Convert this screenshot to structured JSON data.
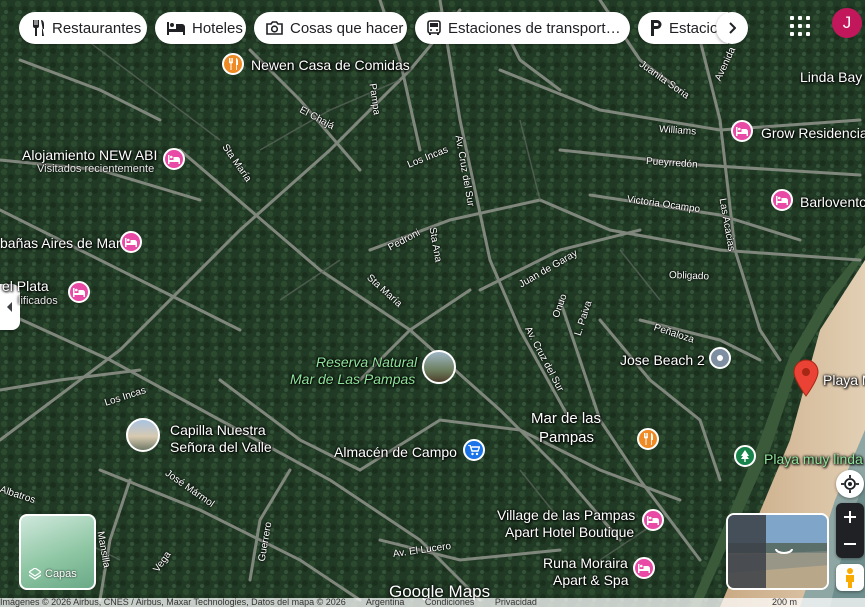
{
  "chips": [
    {
      "label": "Restaurantes",
      "icon": "fork-knife-icon"
    },
    {
      "label": "Hoteles",
      "icon": "bed-icon"
    },
    {
      "label": "Cosas que hacer",
      "icon": "camera-icon"
    },
    {
      "label": "Estaciones de transport…",
      "icon": "bus-icon"
    },
    {
      "label": "Estacio",
      "icon": "parking-icon"
    }
  ],
  "avatar_letter": "J",
  "places": {
    "newen": "Newen Casa de Comidas",
    "linda_bay": "Linda Bay",
    "grow": "Grow Residencia",
    "alojamiento": "Alojamiento NEW ABI",
    "alojamiento_sub": "Visitados recientemente",
    "barlovento": "Barlovento",
    "banas": "bañas Aires de Mar",
    "plata": "el Plata",
    "plata_sub": "lificados",
    "reserva_line1": "Reserva Natural",
    "reserva_line2": "Mar de Las Pampas",
    "jose_beach": "Jose Beach 2",
    "playa": "Playa M",
    "capilla_line1": "Capilla Nuestra",
    "capilla_line2": "Señora del Valle",
    "mar_line1": "Mar de las",
    "mar_line2": "Pampas",
    "almacen": "Almacén de Campo",
    "playa_muy_linda": "Playa muy linda",
    "village_line1": "Village de las Pampas",
    "village_line2": "Apart Hotel Boutique",
    "runa_line1": "Runa Moraira",
    "runa_line2": "Apart & Spa"
  },
  "streets": {
    "cholja": "El Chajá",
    "pampa": "Pampa",
    "sta_maria1": "Sta María",
    "los_incas1": "Los Incas",
    "av_cruz_del_sur1": "Av. Cruz del Sur",
    "juanita_soria": "Juanita Soria",
    "avenida": "Avenida",
    "williams": "Williams",
    "pueyrredon": "Pueyrredón",
    "victoria_ocampo": "Victoria Ocampo",
    "las_acacias": "Las Acacias",
    "pedroni": "Pedroni",
    "sta_ana": "Sta Ana",
    "juan_de_garay": "Juan de Garay",
    "obligado": "Obligado",
    "sta_maria2": "Sta María",
    "onuo": "Onuo",
    "penaloza": "Peñaloza",
    "l_paiva": "L. Paiva",
    "av_cruz_del_sur2": "Av. Cruz del Sur",
    "los_incas2": "Los Incas",
    "jose_marmol": "José Mármol",
    "albatros": "Albatros",
    "mansilla": "Mansilla",
    "vega": "Vega",
    "guerrero": "Guerrero",
    "av_el_lucero": "Av. El Lucero"
  },
  "layers_label": "Capas",
  "logo": "Google Maps",
  "footer": {
    "attribution": "Imágenes © 2026 Airbus, CNES / Airbus, Maxar Technologies, Datos del mapa © 2026",
    "country": "Argentina",
    "terms": "Condiciones",
    "privacy": "Privacidad",
    "scale": "200 m"
  },
  "colors": {
    "hotel": "#e94aa5",
    "food": "#f08a24",
    "shop": "#1a73e8",
    "park": "#17854b",
    "marker": "#ea4335"
  }
}
